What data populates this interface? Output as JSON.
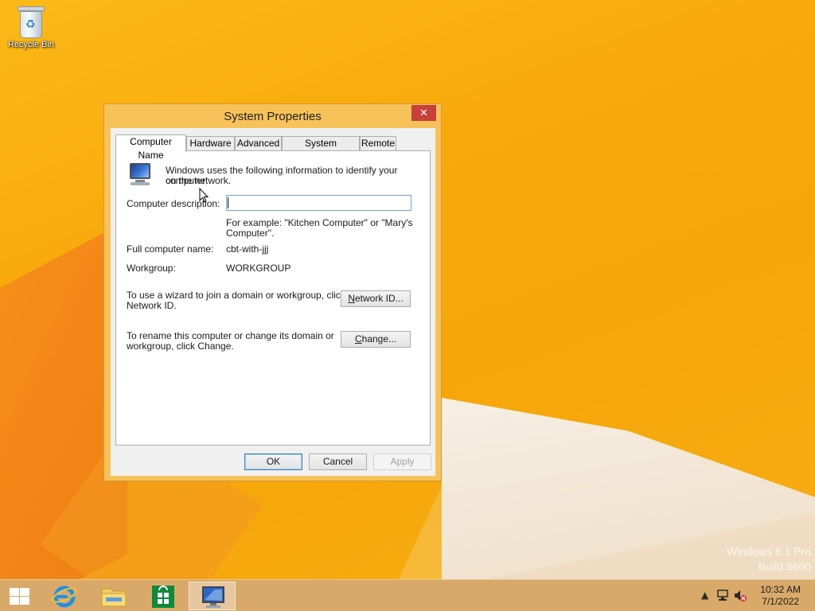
{
  "desktop": {
    "icons": [
      {
        "label": "Recycle Bin",
        "icon": "recycle-bin-icon"
      }
    ],
    "watermark": {
      "line1": "Windows 8.1 Pro",
      "line2": "Build 9600"
    }
  },
  "dialog": {
    "title": "System Properties",
    "close_glyph": "✕",
    "tabs": [
      {
        "label": "Computer Name",
        "active": true
      },
      {
        "label": "Hardware",
        "active": false
      },
      {
        "label": "Advanced",
        "active": false
      },
      {
        "label": "System Protection",
        "active": false
      },
      {
        "label": "Remote",
        "active": false
      }
    ],
    "intro_line1": "Windows uses the following information to identify your computer",
    "intro_line2": "on the network.",
    "description_label": "Computer description:",
    "description_value": "",
    "example_line1": "For example: \"Kitchen Computer\" or \"Mary's",
    "example_line2": "Computer\".",
    "full_name_label": "Full computer name:",
    "full_name_value": "cbt-with-jjj",
    "workgroup_label": "Workgroup:",
    "workgroup_value": "WORKGROUP",
    "network_text_line1": "To use a wizard to join a domain or workgroup, click",
    "network_text_line2": "Network ID.",
    "network_button": {
      "underline": "N",
      "rest": "etwork ID..."
    },
    "rename_text_line1": "To rename this computer or change its domain or",
    "rename_text_line2": "workgroup, click Change.",
    "change_button": {
      "underline": "C",
      "rest": "hange..."
    },
    "ok_label": "OK",
    "cancel_label": "Cancel",
    "apply_label": "Apply"
  },
  "taskbar": {
    "pinned": [
      {
        "name": "start",
        "icon": "windows-logo-icon"
      },
      {
        "name": "internet-explorer",
        "icon": "internet-explorer-icon"
      },
      {
        "name": "file-explorer",
        "icon": "folder-icon"
      },
      {
        "name": "store",
        "icon": "store-icon"
      },
      {
        "name": "system-properties",
        "icon": "computer-icon",
        "active": true
      }
    ],
    "clock": {
      "time": "10:32 AM",
      "date": "7/1/2022"
    }
  },
  "colors": {
    "desktop": "#f8a90c",
    "dialog_frame": "#f7c25a",
    "close": "#c7403b",
    "taskbar": "#d9a96a"
  }
}
